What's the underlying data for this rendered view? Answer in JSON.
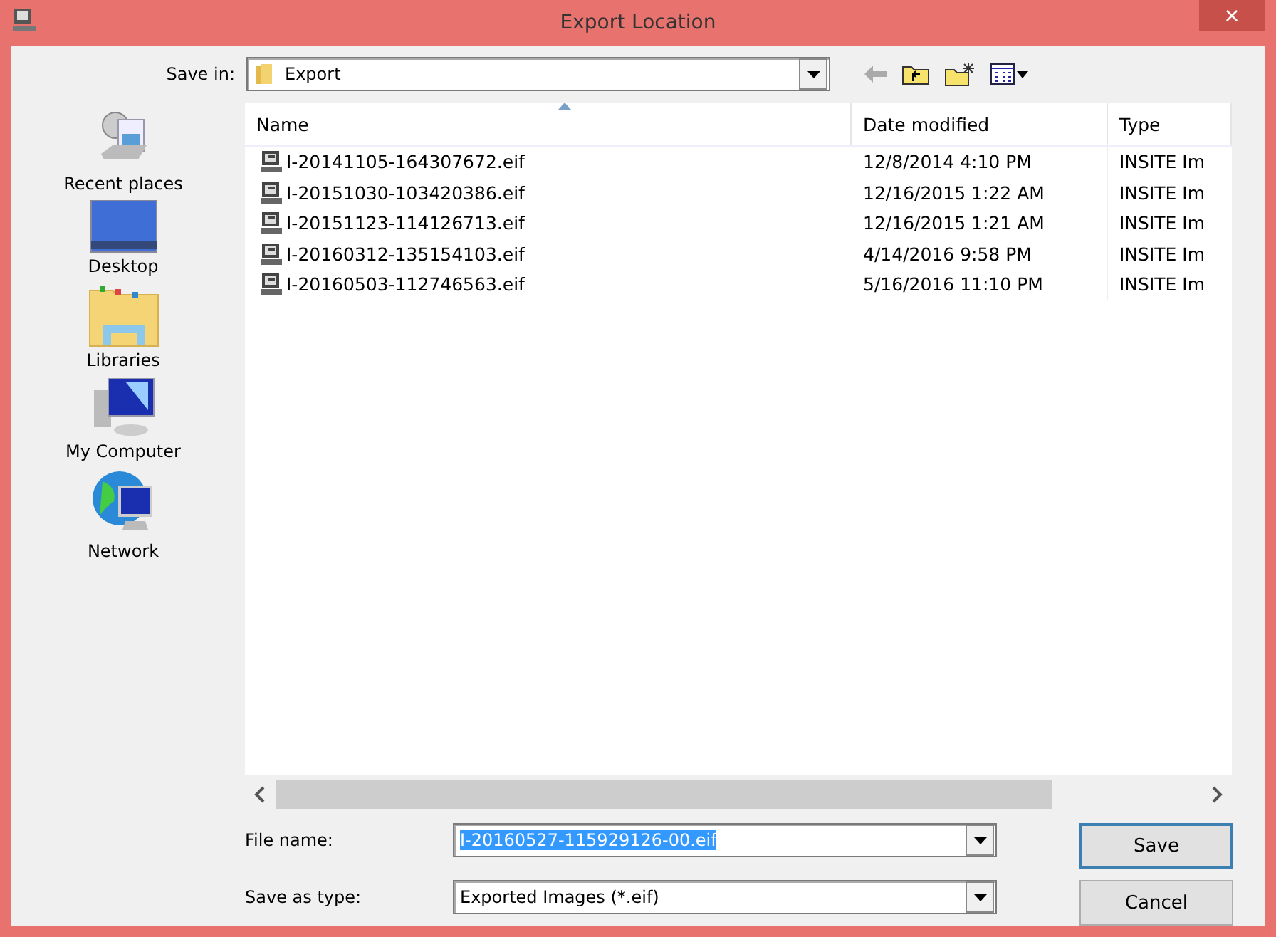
{
  "window": {
    "title": "Export Location",
    "close": "×"
  },
  "save_in": {
    "label": "Save in:",
    "value": "Export"
  },
  "places": [
    {
      "kind": "recent",
      "label": "Recent places"
    },
    {
      "kind": "desktop",
      "label": "Desktop"
    },
    {
      "kind": "libraries",
      "label": "Libraries"
    },
    {
      "kind": "computer",
      "label": "My Computer"
    },
    {
      "kind": "network",
      "label": "Network"
    }
  ],
  "table": {
    "columns": [
      "Name",
      "Date modified",
      "Type"
    ],
    "rows": [
      {
        "name": "I-20141105-164307672.eif",
        "date": "12/8/2014 4:10 PM",
        "type": "INSITE Im"
      },
      {
        "name": "I-20151030-103420386.eif",
        "date": "12/16/2015 1:22 AM",
        "type": "INSITE Im"
      },
      {
        "name": "I-20151123-114126713.eif",
        "date": "12/16/2015 1:21 AM",
        "type": "INSITE Im"
      },
      {
        "name": "I-20160312-135154103.eif",
        "date": "4/14/2016 9:58 PM",
        "type": "INSITE Im"
      },
      {
        "name": "I-20160503-112746563.eif",
        "date": "5/16/2016 11:10 PM",
        "type": "INSITE Im"
      }
    ]
  },
  "file_name": {
    "label": "File name:",
    "value": "I-20160527-115929126-00.eif",
    "selected": true
  },
  "save_as_type": {
    "label": "Save as type:",
    "value": "Exported Images (*.eif)"
  },
  "buttons": [
    "Save",
    "Cancel"
  ]
}
